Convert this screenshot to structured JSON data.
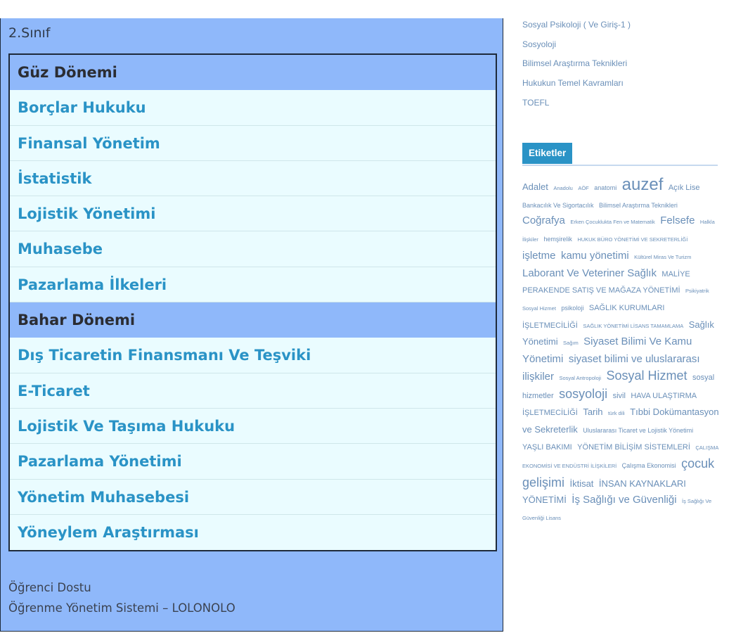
{
  "panel": {
    "title": "2.Sınıf",
    "sections": [
      {
        "heading": "Güz Dönemi",
        "courses": [
          "Borçlar Hukuku",
          "Finansal Yönetim",
          "İstatistik",
          "Lojistik Yönetimi",
          "Muhasebe",
          "Pazarlama İlkeleri"
        ]
      },
      {
        "heading": "Bahar Dönemi",
        "courses": [
          "Dış Ticaretin Finansmanı Ve Teşviki",
          "E-Ticaret",
          "Lojistik Ve Taşıma Hukuku",
          "Pazarlama Yönetimi",
          "Yönetim Muhasebesi",
          "Yöneylem Araştırması"
        ]
      }
    ],
    "footer": {
      "line1": "Öğrenci Dostu",
      "line2": "Öğrenme Yönetim Sistemi – LOLONOLO"
    }
  },
  "sidebar": {
    "links": [
      "Sosyal Psikoloji ( Ve Giriş-1 )",
      "Sosyoloji",
      "Bilimsel Araştırma Teknikleri",
      "Hukukun Temel Kavramları",
      "TOEFL"
    ],
    "tags_title": "Etiketler",
    "tags": [
      {
        "label": "Adalet",
        "size": 4
      },
      {
        "label": "Anadolu",
        "size": 1
      },
      {
        "label": "AÖF",
        "size": 1
      },
      {
        "label": "anatomi",
        "size": 2
      },
      {
        "label": "auzef",
        "size": 8
      },
      {
        "label": "Açık Lise",
        "size": 3
      },
      {
        "label": "Bankacılık Ve Sigortacılık",
        "size": 2
      },
      {
        "label": "Bilimsel Araştırma Teknikleri",
        "size": 2
      },
      {
        "label": "Coğrafya",
        "size": 5
      },
      {
        "label": "Erken Çocuklukta Fen ve Matematik",
        "size": 1
      },
      {
        "label": "Felsefe",
        "size": 5
      },
      {
        "label": "Halkla İlişkiler",
        "size": 1
      },
      {
        "label": "hemşirelik",
        "size": 2
      },
      {
        "label": "HUKUK BÜRO YÖNETİMİ VE SEKRETERLİĞİ",
        "size": 1
      },
      {
        "label": "işletme",
        "size": 5
      },
      {
        "label": "kamu yönetimi",
        "size": 5
      },
      {
        "label": "Kültürel Miras Ve Turizm",
        "size": 1
      },
      {
        "label": "Laborant Ve Veteriner Sağlık",
        "size": 5
      },
      {
        "label": "MALİYE",
        "size": 3
      },
      {
        "label": "PERAKENDE SATIŞ VE MAĞAZA YÖNETİMİ",
        "size": 3
      },
      {
        "label": "Psikiyatrik",
        "size": 1
      },
      {
        "label": "Sosyal Hizmet",
        "size": 1
      },
      {
        "label": "psikoloji",
        "size": 2
      },
      {
        "label": "SAĞLIK KURUMLARI İŞLETMECİLİĞİ",
        "size": 3
      },
      {
        "label": "SAĞLIK YÖNETİMİ LİSANS TAMAMLAMA",
        "size": 1
      },
      {
        "label": "Sağlık Yönetimi",
        "size": 4
      },
      {
        "label": "Sağım",
        "size": 1
      },
      {
        "label": "Siyaset Bilimi Ve Kamu Yönetimi",
        "size": 5
      },
      {
        "label": "siyaset bilimi ve uluslararası ilişkiler",
        "size": 5
      },
      {
        "label": "Sosyal Antropoloji",
        "size": 1
      },
      {
        "label": "Sosyal Hizmet",
        "size": 6
      },
      {
        "label": "sosyal hizmetler",
        "size": 3
      },
      {
        "label": "sosyoloji",
        "size": 6
      },
      {
        "label": "sivil",
        "size": 3
      },
      {
        "label": "HAVA ULAŞTIRMA İŞLETMECİLİĞİ",
        "size": 3
      },
      {
        "label": "Tarih",
        "size": 4
      },
      {
        "label": "türk dili",
        "size": 1
      },
      {
        "label": "Tıbbi Dokümantasyon ve Sekreterlik",
        "size": 4
      },
      {
        "label": "Uluslararası Ticaret ve Lojistik Yönetimi",
        "size": 2
      },
      {
        "label": "YAŞLI BAKIMI",
        "size": 3
      },
      {
        "label": "YÖNETİM BİLİŞİM SİSTEMLERİ",
        "size": 3
      },
      {
        "label": "ÇALIŞMA EKONOMİSİ VE ENDÜSTRİ İLİŞKİLERİ",
        "size": 1
      },
      {
        "label": "Çalışma Ekonomisi",
        "size": 2
      },
      {
        "label": "çocuk gelişimi",
        "size": 6
      },
      {
        "label": "İktisat",
        "size": 4
      },
      {
        "label": "İNSAN KAYNAKLARI YÖNETİMİ",
        "size": 4
      },
      {
        "label": "İş Sağlığı ve Güvenliği",
        "size": 5
      },
      {
        "label": "İş Sağlığı Ve Güvenliği Lisans",
        "size": 1
      }
    ]
  }
}
